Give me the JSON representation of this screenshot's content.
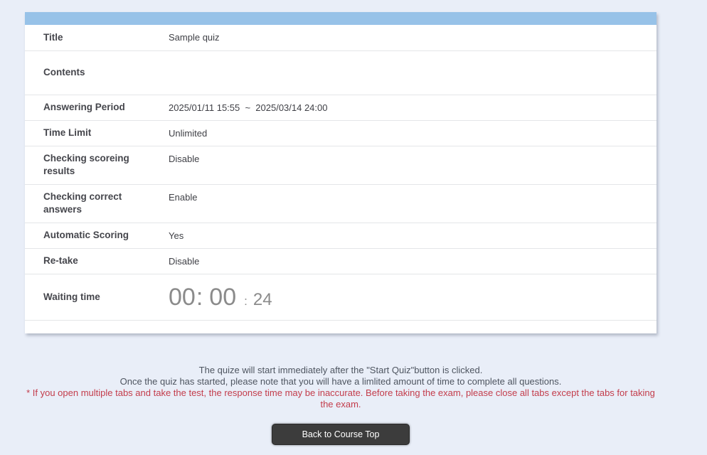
{
  "colors": {
    "page_background": "#e9eef8",
    "header_bar": "#97c2e8",
    "warning_text": "#c33c4b",
    "button_background": "#3c3c3c",
    "timer_text": "#8b8b8b"
  },
  "table": {
    "rows": [
      {
        "label": "Title",
        "value": "Sample quiz"
      },
      {
        "label": "Contents",
        "value": ""
      },
      {
        "label": "Answering Period",
        "value": "2025/01/11 15:55  ~  2025/03/14 24:00"
      },
      {
        "label": "Time Limit",
        "value": "Unlimited"
      },
      {
        "label": "Checking scoreing results",
        "value": "Disable"
      },
      {
        "label": "Checking correct answers",
        "value": "Enable"
      },
      {
        "label": "Automatic Scoring",
        "value": "Yes"
      },
      {
        "label": "Re-take",
        "value": "Disable"
      },
      {
        "label": "Waiting time"
      }
    ]
  },
  "timer": {
    "hours": "00",
    "minutes": "00",
    "seconds": "24",
    "separator": ":"
  },
  "notes": {
    "line1": "The quize will start immediately after the \"Start Quiz\"button is clicked.",
    "line2": "Once the quiz has started, please note that you will have a limlited amount of time to complete all questions.",
    "warning": "* If you open multiple tabs and take the test, the response time may be inaccurate. Before taking the exam, please close all tabs except the tabs for taking the exam."
  },
  "button": {
    "label": "Back to Course Top"
  }
}
